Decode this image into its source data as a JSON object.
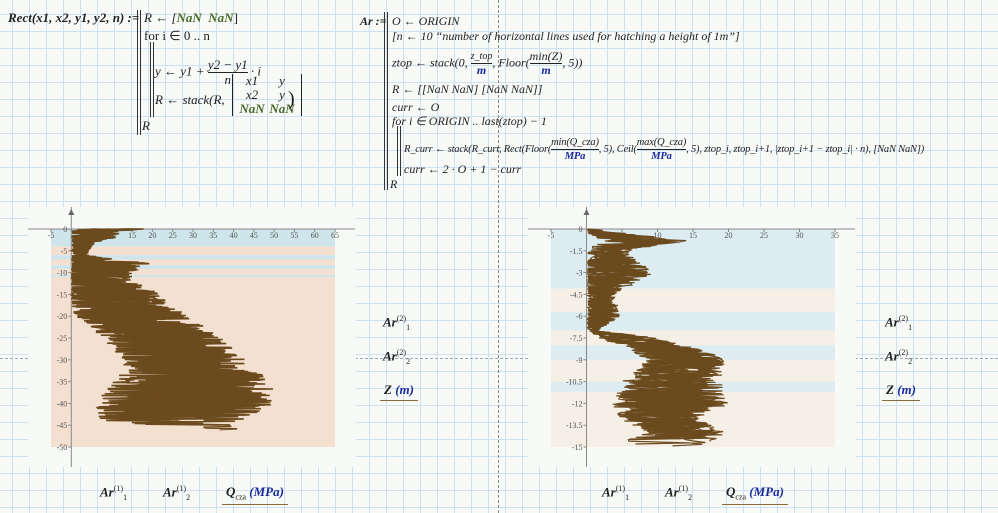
{
  "rect_def": {
    "head": "Rect(x1, x2, y1, y2, n) :=",
    "line1": "R ← [",
    "nan": "NaN",
    "line2": "for i ∈ 0 .. n",
    "line3a": "y ← y1 +",
    "line3num": "y2 − y1",
    "line3den": "n",
    "line3b": "· i",
    "line4a": "R ← stack(R,",
    "matrix": [
      [
        "x1",
        "y"
      ],
      [
        "x2",
        "y"
      ],
      [
        "NaN",
        "NaN"
      ]
    ],
    "line5": "R"
  },
  "ar_def": {
    "head": "Ar :=",
    "l1": "O ← ORIGIN",
    "l2": "[n ← 10  “number of horizontal lines used for hatching a height of 1m”]",
    "l3a": "ztop ← stack(0,",
    "l3num": "z_top",
    "l3den": "m",
    "l3b": ", Floor(",
    "l3num2": "min(Z)",
    "l3den2": "m",
    "l3c": ", 5))",
    "l4": "R ← [[NaN  NaN] [NaN  NaN]]",
    "l5": "curr ← O",
    "l6": "for i ∈ ORIGIN .. last(ztop) − 1",
    "l7a": "R_curr ← stack(R_curr, Rect(Floor(",
    "l7num1": "min(Q_cza)",
    "l7den": "MPa",
    "l7b": ", 5), Ceil(",
    "l7num2": "max(Q_cza)",
    "l7c": ", 5), ztop_i, ztop_i+1, |ztop_i+1 − ztop_i| · n), [NaN  NaN])",
    "l8": "curr ← 2 · O + 1 − curr",
    "l9": "R"
  },
  "legend": {
    "ar1_2": "Ar",
    "sub1": "1",
    "sub2": "2",
    "sup2": "(2)",
    "sup1": "(1)",
    "z_label": "Z",
    "z_unit": "(m)",
    "q_label": "Q",
    "q_sub": "cza",
    "q_unit": "(MPa)"
  },
  "chart_data": [
    {
      "type": "line",
      "xlabel": "Q_cza (MPa)",
      "ylabel": "Z (m)",
      "xlim": [
        -5,
        65
      ],
      "ylim": [
        -50,
        0
      ],
      "xticks": [
        -5,
        0,
        5,
        10,
        15,
        20,
        25,
        30,
        35,
        40,
        45,
        50,
        55,
        60,
        65
      ],
      "yticks": [
        0,
        -5,
        -10,
        -15,
        -20,
        -25,
        -30,
        -35,
        -40,
        -45,
        -50
      ],
      "hatch_bands": [
        {
          "z_top": 0,
          "z_bottom": -4,
          "color": "#cfe5ec"
        },
        {
          "z_top": -4,
          "z_bottom": -6,
          "color": "#f4e0d0"
        },
        {
          "z_top": -6,
          "z_bottom": -7,
          "color": "#cfe5ec"
        },
        {
          "z_top": -7,
          "z_bottom": -8.3,
          "color": "#f4e0d0"
        },
        {
          "z_top": -8.3,
          "z_bottom": -9.2,
          "color": "#cfe5ec"
        },
        {
          "z_top": -9.2,
          "z_bottom": -10.5,
          "color": "#f4e0d0"
        },
        {
          "z_top": -10.5,
          "z_bottom": -11,
          "color": "#cfe5ec"
        },
        {
          "z_top": -11,
          "z_bottom": -50,
          "color": "#f4e0d0"
        }
      ],
      "trace_color": "#6b4a1e",
      "profile_z": [
        0,
        -1,
        -3,
        -6,
        -8,
        -10,
        -12,
        -15,
        -20,
        -25,
        -30,
        -35,
        -40,
        -44,
        -46
      ],
      "profile_qc_mean": [
        8,
        6,
        3,
        2,
        8,
        5,
        6,
        10,
        15,
        22,
        28,
        30,
        28,
        25,
        38
      ],
      "profile_qc_spread": [
        10,
        10,
        3,
        2,
        12,
        10,
        10,
        12,
        14,
        15,
        15,
        20,
        22,
        18,
        5
      ]
    },
    {
      "type": "line",
      "xlabel": "Q_cza (MPa)",
      "ylabel": "Z (m)",
      "xlim": [
        -5,
        35
      ],
      "ylim": [
        -15,
        0
      ],
      "xticks": [
        -5,
        0,
        5,
        10,
        15,
        20,
        25,
        30,
        35
      ],
      "yticks": [
        0,
        -1.5,
        -3,
        -4.5,
        -6,
        -7.5,
        -9,
        -10.5,
        -12,
        -13.5,
        -15
      ],
      "hatch_bands": [
        {
          "z_top": 0,
          "z_bottom": -4.1,
          "color": "#dcecf0"
        },
        {
          "z_top": -4.1,
          "z_bottom": -5.7,
          "color": "#f6efe6"
        },
        {
          "z_top": -5.7,
          "z_bottom": -7,
          "color": "#dcecf0"
        },
        {
          "z_top": -7,
          "z_bottom": -8,
          "color": "#f6efe6"
        },
        {
          "z_top": -8,
          "z_bottom": -9,
          "color": "#dcecf0"
        },
        {
          "z_top": -9,
          "z_bottom": -10.5,
          "color": "#f6efe6"
        },
        {
          "z_top": -10.5,
          "z_bottom": -11.2,
          "color": "#dcecf0"
        },
        {
          "z_top": -11.2,
          "z_bottom": -15,
          "color": "#f6efe6"
        }
      ],
      "trace_color": "#6b4a1e",
      "profile_z": [
        0,
        -0.8,
        -1.5,
        -3,
        -4.5,
        -6,
        -7,
        -7.5,
        -8.5,
        -9,
        -10.5,
        -12,
        -13,
        -14,
        -15
      ],
      "profile_qc_mean": [
        0,
        8,
        3,
        4,
        2,
        2,
        1,
        6,
        12,
        14,
        12,
        12,
        10,
        14,
        10
      ],
      "profile_qc_spread": [
        1,
        9,
        4,
        8,
        3,
        4,
        1,
        6,
        8,
        8,
        10,
        12,
        8,
        8,
        10
      ]
    }
  ]
}
